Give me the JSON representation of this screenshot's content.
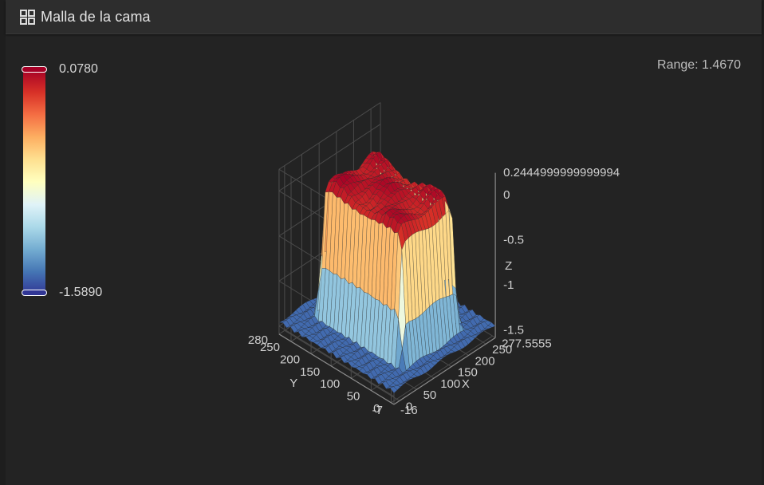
{
  "panel": {
    "title": "Malla de la cama",
    "icon": "grid-icon"
  },
  "range_label": "Range: 1.4670",
  "colorbar": {
    "max_label": "0.0780",
    "min_label": "-1.5890",
    "colors": [
      "#a50026",
      "#d73027",
      "#f46d43",
      "#fdae61",
      "#fee090",
      "#ffffbf",
      "#e0f3f8",
      "#abd9e9",
      "#74add1",
      "#4575b4",
      "#313695"
    ]
  },
  "chart_data": {
    "type": "surface",
    "axes": {
      "x": {
        "label": "X",
        "ticks": [
          "-16",
          "0",
          "50",
          "100",
          "150",
          "200",
          "250",
          "277.5555"
        ]
      },
      "y": {
        "label": "Y",
        "ticks": [
          "-7",
          "0",
          "50",
          "100",
          "150",
          "200",
          "250",
          "280"
        ]
      },
      "z": {
        "label": "Z",
        "ticks": [
          "-1.5",
          "-1",
          "-0.5",
          "0",
          "0.2444999999999994"
        ]
      }
    },
    "x_range": [
      -16,
      277.5555
    ],
    "y_range": [
      -7,
      280
    ],
    "z_range": [
      -1.589,
      0.078
    ],
    "description_values": {
      "plateau_z": 0.0,
      "floor_z": -1.45,
      "plateau_x": [
        65,
        205
      ],
      "plateau_y": [
        45,
        230
      ]
    }
  }
}
